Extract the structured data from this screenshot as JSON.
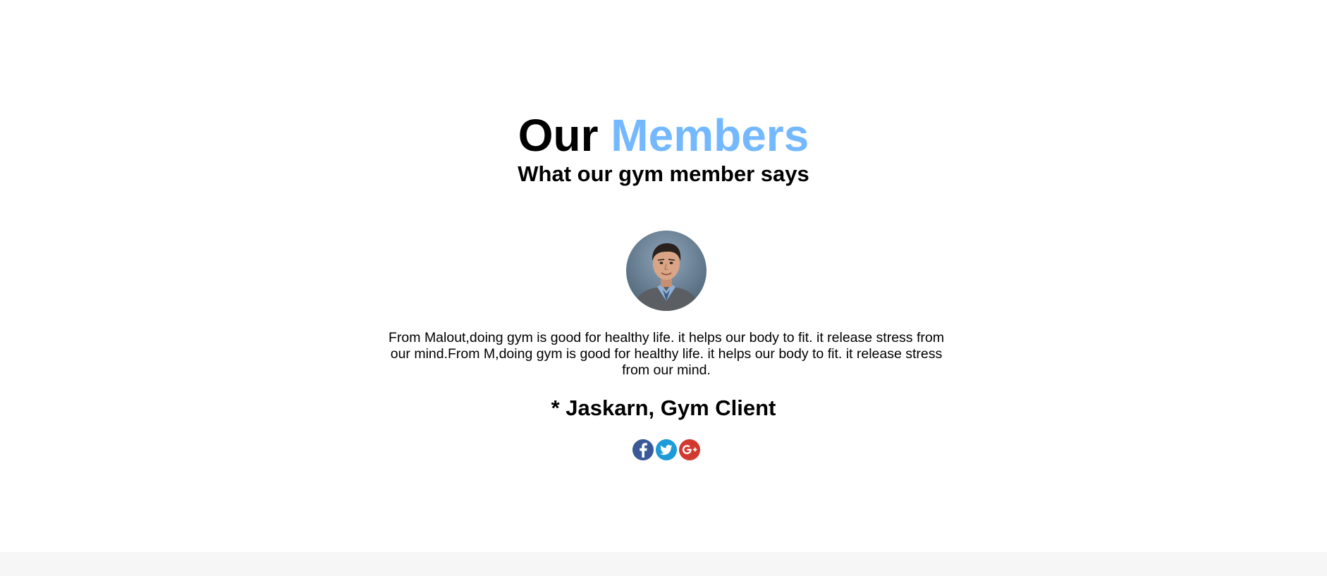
{
  "section": {
    "heading_part1": "Our",
    "heading_part2": "Members",
    "subheading": "What our gym member says"
  },
  "testimonial": {
    "text": "From Malout,doing gym is good for healthy life. it helps our body to fit. it release stress from our mind.From M,doing gym is good for healthy life. it helps our body to fit. it release stress from our mind.",
    "client": "* Jaskarn, Gym Client",
    "avatar_icon": "member-portrait"
  },
  "social": [
    {
      "name": "facebook",
      "icon": "facebook-icon",
      "color": "#3b5998"
    },
    {
      "name": "twitter",
      "icon": "twitter-icon",
      "color": "#1d9bd9"
    },
    {
      "name": "google-plus",
      "icon": "google-plus-icon",
      "color": "#d23a2f"
    }
  ],
  "colors": {
    "accent": "#74b9ff",
    "background": "#ffffff",
    "footer_band": "#f6f6f6"
  }
}
